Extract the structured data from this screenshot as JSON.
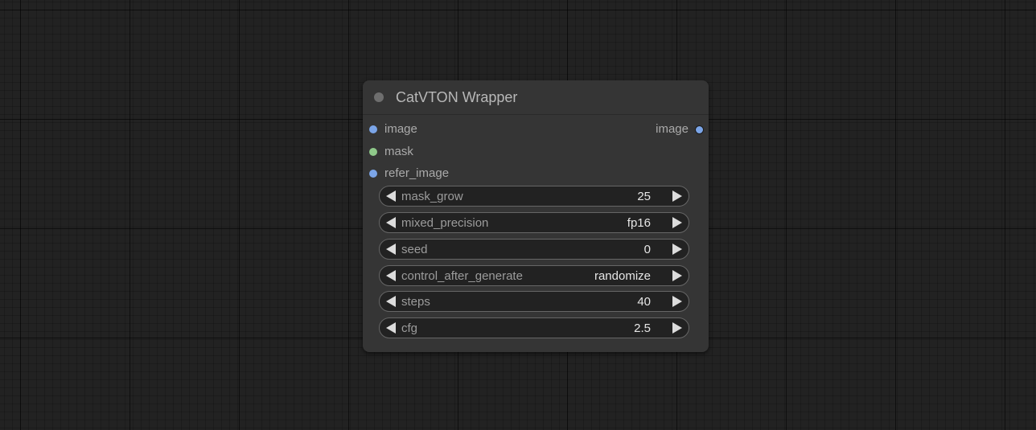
{
  "node": {
    "title": "CatVTON Wrapper",
    "inputs": [
      {
        "label": "image",
        "color": "#7ba5e8"
      },
      {
        "label": "mask",
        "color": "#8fc98a"
      },
      {
        "label": "refer_image",
        "color": "#7ba5e8"
      }
    ],
    "outputs": [
      {
        "label": "image",
        "color": "#7ba5e8"
      }
    ],
    "widgets": [
      {
        "label": "mask_grow",
        "value": "25"
      },
      {
        "label": "mixed_precision",
        "value": "fp16"
      },
      {
        "label": "seed",
        "value": "0"
      },
      {
        "label": "control_after_generate",
        "value": "randomize"
      },
      {
        "label": "steps",
        "value": "40"
      },
      {
        "label": "cfg",
        "value": "2.5"
      }
    ]
  },
  "icons": {
    "collapse": "circle-dot-icon",
    "decrement": "triangle-left-icon",
    "increment": "triangle-right-icon"
  }
}
